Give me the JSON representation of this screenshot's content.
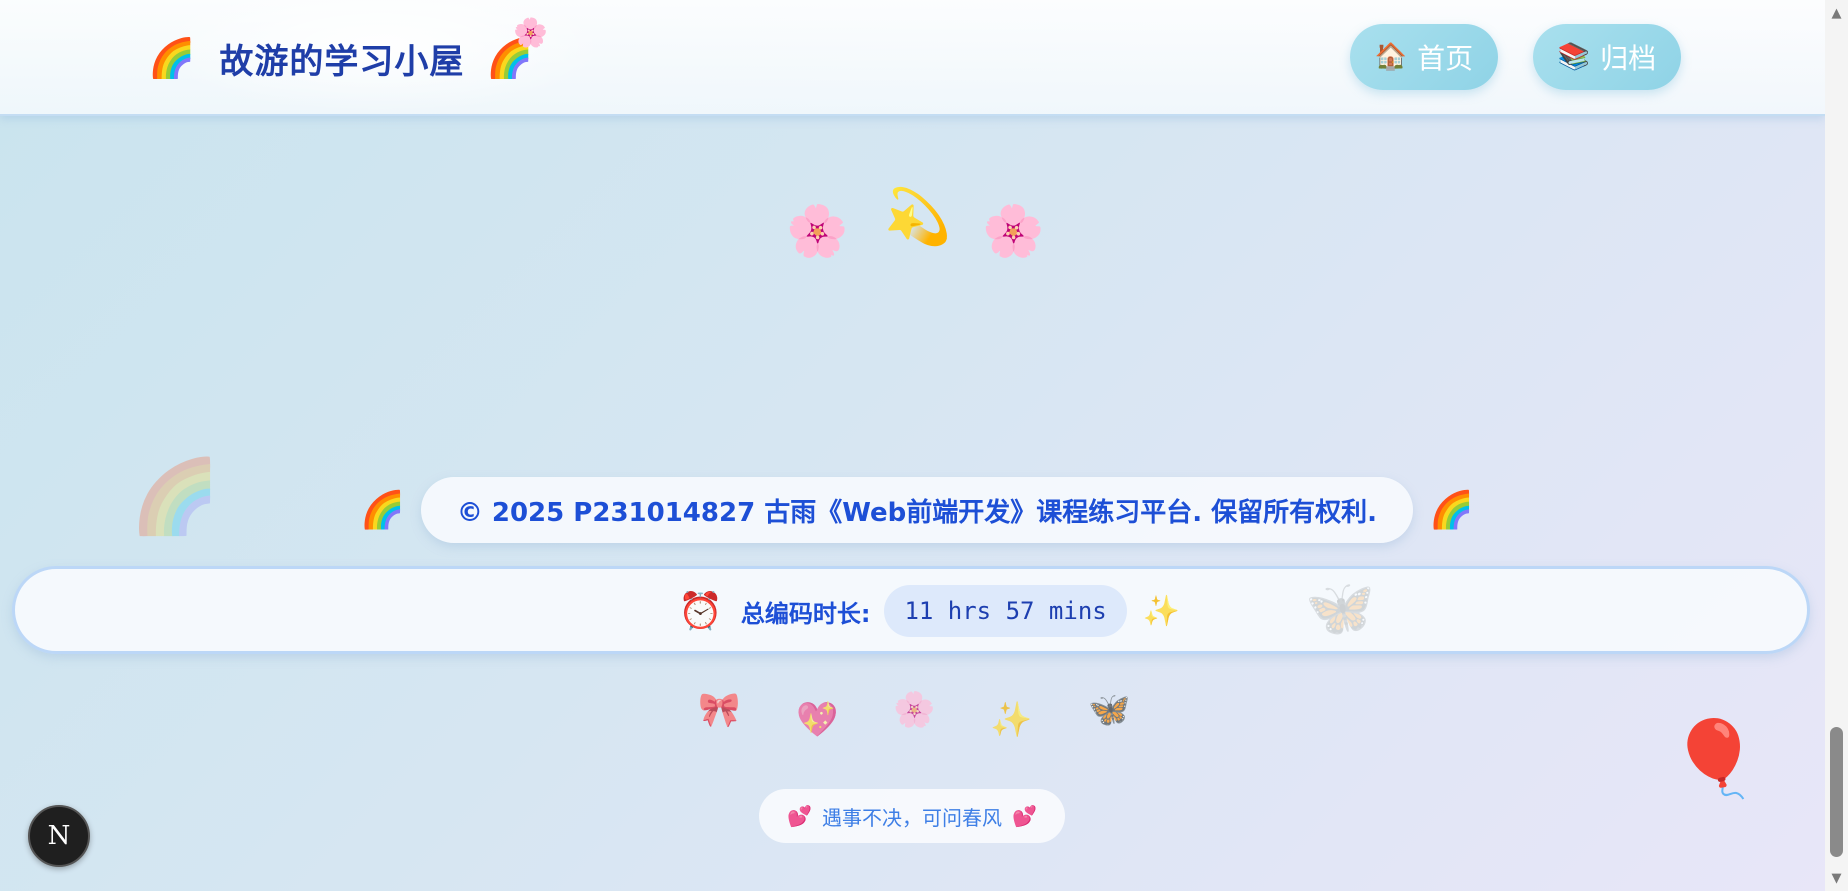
{
  "header": {
    "title": "故游的学习小屋",
    "left_icon": "🌈",
    "right_icon": "🌈",
    "flower_icon": "🌸",
    "nav": [
      {
        "icon": "🏠",
        "label": "首页"
      },
      {
        "icon": "📚",
        "label": "归档"
      }
    ]
  },
  "decorations": {
    "top": [
      "🌸",
      "💫",
      "🌸"
    ],
    "rainbow_faded": "🌈",
    "butterfly_faded": "🦋",
    "balloon": "🎈"
  },
  "footer": {
    "copyright": "© 2025 P231014827 古雨《Web前端开发》课程练习平台. 保留所有权利.",
    "copyright_icon": "🌈",
    "coding_time": {
      "icon": "⏰",
      "label": "总编码时长:",
      "value": "11 hrs 57 mins",
      "trail_icon": "✨"
    },
    "emoji_row": [
      "🎀",
      "💖",
      "🌸",
      "✨",
      "🦋"
    ],
    "motto": {
      "icon": "💕",
      "text": "遇事不决，可问春风"
    }
  },
  "next_badge": "N",
  "colors": {
    "accent": "#1d4fd6",
    "nav_bg": "#8fd3e6",
    "bar_border": "#bcd7f7"
  }
}
